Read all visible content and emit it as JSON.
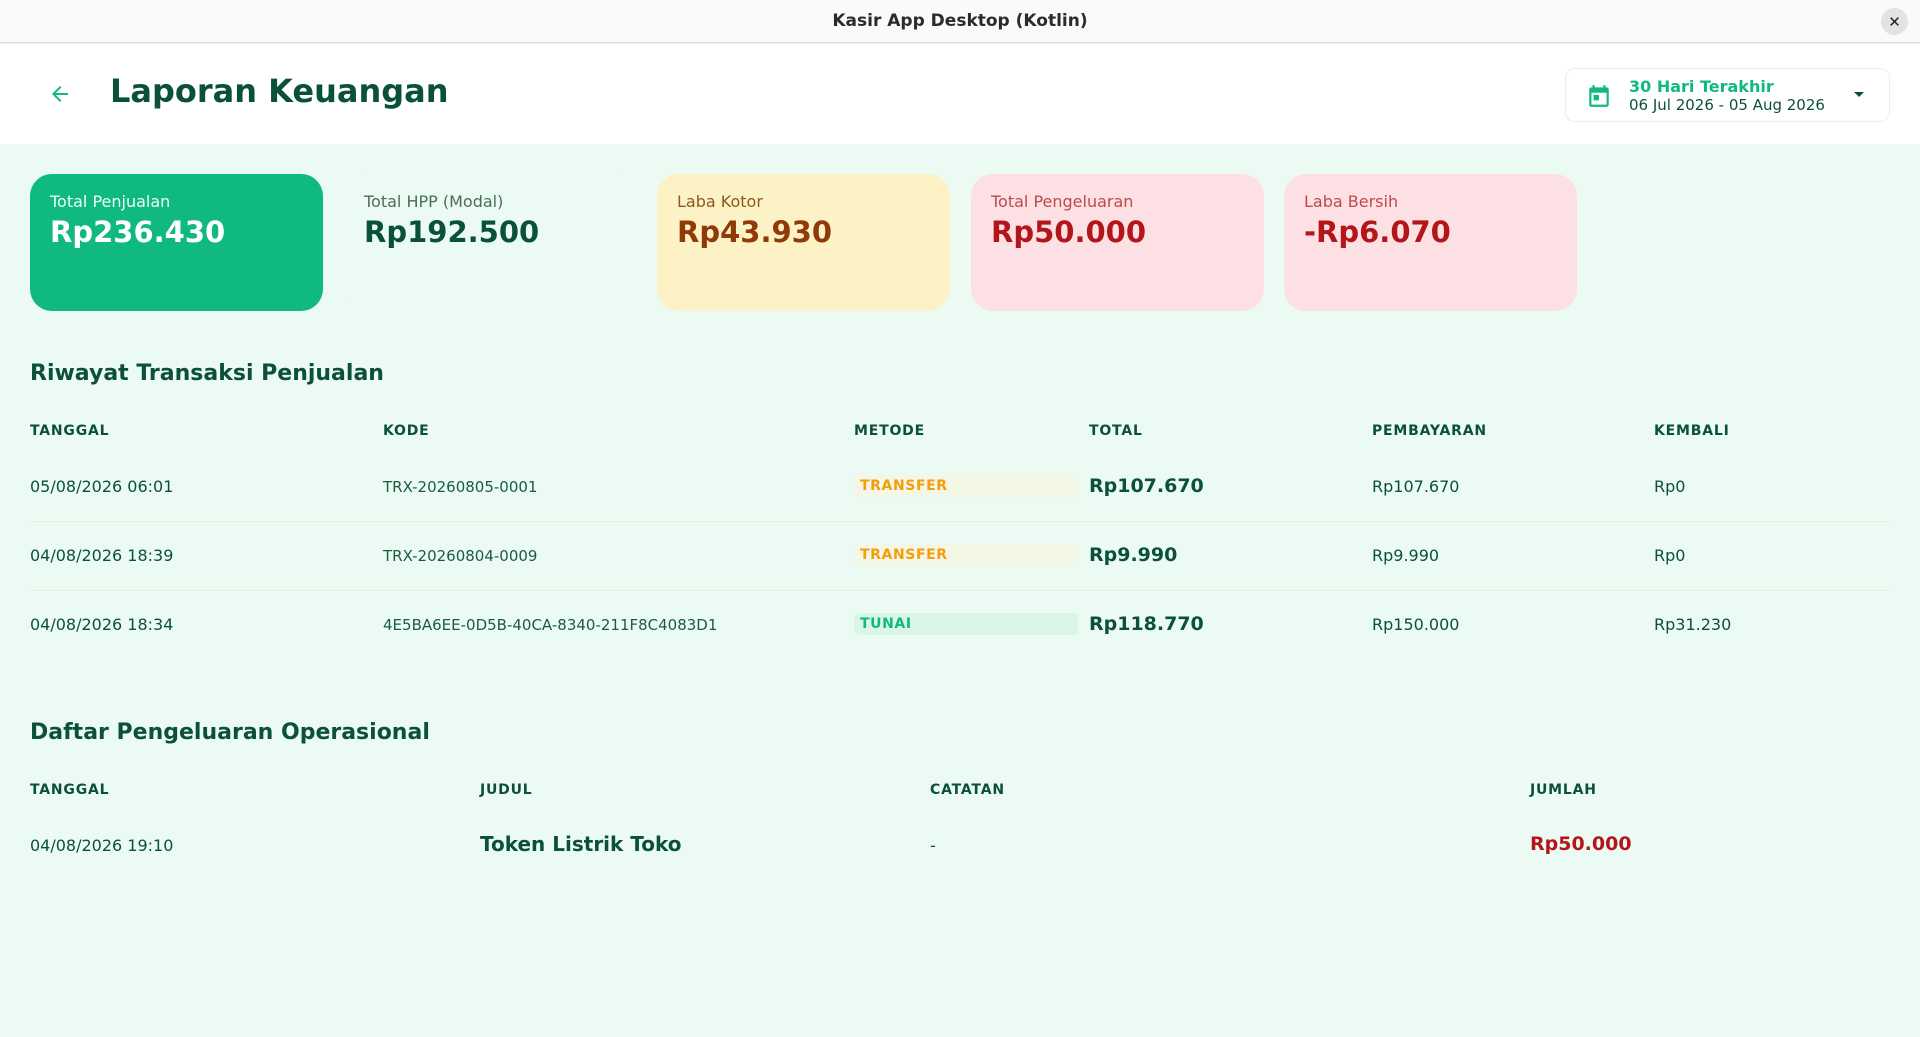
{
  "window": {
    "title": "Kasir App Desktop (Kotlin)",
    "close_glyph": "✕"
  },
  "header": {
    "title": "Laporan Keuangan",
    "date_filter": {
      "label": "30 Hari Terakhir",
      "range": "06 Jul 2026 - 05 Aug 2026"
    }
  },
  "summary": [
    {
      "label": "Total Penjualan",
      "value": "Rp236.430"
    },
    {
      "label": "Total HPP (Modal)",
      "value": "Rp192.500"
    },
    {
      "label": "Laba Kotor",
      "value": "Rp43.930"
    },
    {
      "label": "Total Pengeluaran",
      "value": "Rp50.000"
    },
    {
      "label": "Laba Bersih",
      "value": "-Rp6.070"
    }
  ],
  "sales": {
    "title": "Riwayat Transaksi Penjualan",
    "columns": [
      "TANGGAL",
      "KODE",
      "METODE",
      "TOTAL",
      "PEMBAYARAN",
      "KEMBALI"
    ],
    "rows": [
      {
        "date": "05/08/2026 06:01",
        "code": "TRX-20260805-0001",
        "method": "TRANSFER",
        "total": "Rp107.670",
        "payment": "Rp107.670",
        "change": "Rp0"
      },
      {
        "date": "04/08/2026 18:39",
        "code": "TRX-20260804-0009",
        "method": "TRANSFER",
        "total": "Rp9.990",
        "payment": "Rp9.990",
        "change": "Rp0"
      },
      {
        "date": "04/08/2026 18:34",
        "code": "4E5BA6EE-0D5B-40CA-8340-211F8C4083D1",
        "method": "TUNAI",
        "total": "Rp118.770",
        "payment": "Rp150.000",
        "change": "Rp31.230"
      }
    ]
  },
  "expenses": {
    "title": "Daftar Pengeluaran Operasional",
    "columns": [
      "TANGGAL",
      "JUDUL",
      "CATATAN",
      "JUMLAH"
    ],
    "rows": [
      {
        "date": "04/08/2026 19:10",
        "title": "Token Listrik Toko",
        "note": "-",
        "amount": "Rp50.000"
      }
    ]
  },
  "colors": {
    "brand": "#10b981",
    "text_dark": "#0b5139",
    "danger": "#b3151b",
    "transfer_badge": "#f59e0b"
  },
  "icons": [
    "arrow-back-icon",
    "calendar-icon",
    "dropdown-caret-icon",
    "close-icon"
  ]
}
